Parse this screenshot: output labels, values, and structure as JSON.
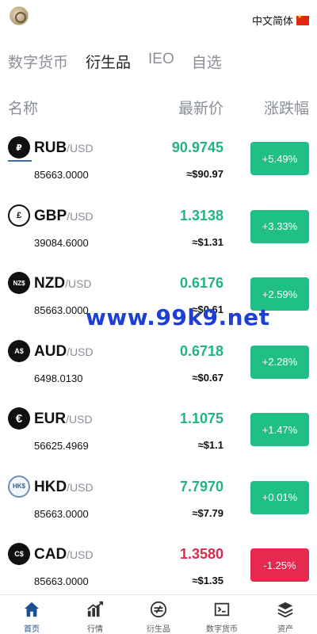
{
  "header": {
    "language": "中文简体"
  },
  "tabs": [
    {
      "label": "数字货币"
    },
    {
      "label": "衍生品"
    },
    {
      "label": "IEO"
    },
    {
      "label": "自选"
    }
  ],
  "columns": {
    "name": "名称",
    "price": "最新价",
    "change": "涨跌幅"
  },
  "rows": [
    {
      "symbol": "RUB",
      "quote": "/USD",
      "volume": "85663.0000",
      "price": "90.9745",
      "usd": "≈$90.97",
      "change": "+5.49%",
      "icon_glyph": "₽"
    },
    {
      "symbol": "GBP",
      "quote": "/USD",
      "volume": "39084.6000",
      "price": "1.3138",
      "usd": "≈$1.31",
      "change": "+3.33%",
      "icon_glyph": "£"
    },
    {
      "symbol": "NZD",
      "quote": "/USD",
      "volume": "85663.0000",
      "price": "0.6176",
      "usd": "≈$0.61",
      "change": "+2.59%",
      "icon_glyph": "NZ$"
    },
    {
      "symbol": "AUD",
      "quote": "/USD",
      "volume": "6498.0130",
      "price": "0.6718",
      "usd": "≈$0.67",
      "change": "+2.28%",
      "icon_glyph": "A$"
    },
    {
      "symbol": "EUR",
      "quote": "/USD",
      "volume": "56625.4969",
      "price": "1.1075",
      "usd": "≈$1.1",
      "change": "+1.47%",
      "icon_glyph": "€"
    },
    {
      "symbol": "HKD",
      "quote": "/USD",
      "volume": "85663.0000",
      "price": "7.7970",
      "usd": "≈$7.79",
      "change": "+0.01%",
      "icon_glyph": "HK$"
    },
    {
      "symbol": "CAD",
      "quote": "/USD",
      "volume": "85663.0000",
      "price": "1.3580",
      "usd": "≈$1.35",
      "change": "-1.25%",
      "icon_glyph": "C$"
    }
  ],
  "watermark": "www.99k9.net",
  "nav": [
    {
      "label": "首页"
    },
    {
      "label": "行情"
    },
    {
      "label": "衍生品"
    },
    {
      "label": "数字货币"
    },
    {
      "label": "资产"
    }
  ],
  "colors": {
    "up": "#21b47f",
    "down": "#e0284f",
    "badge_up": "#1fbf86",
    "badge_down": "#e8294f",
    "active_nav": "#1d4f91"
  }
}
